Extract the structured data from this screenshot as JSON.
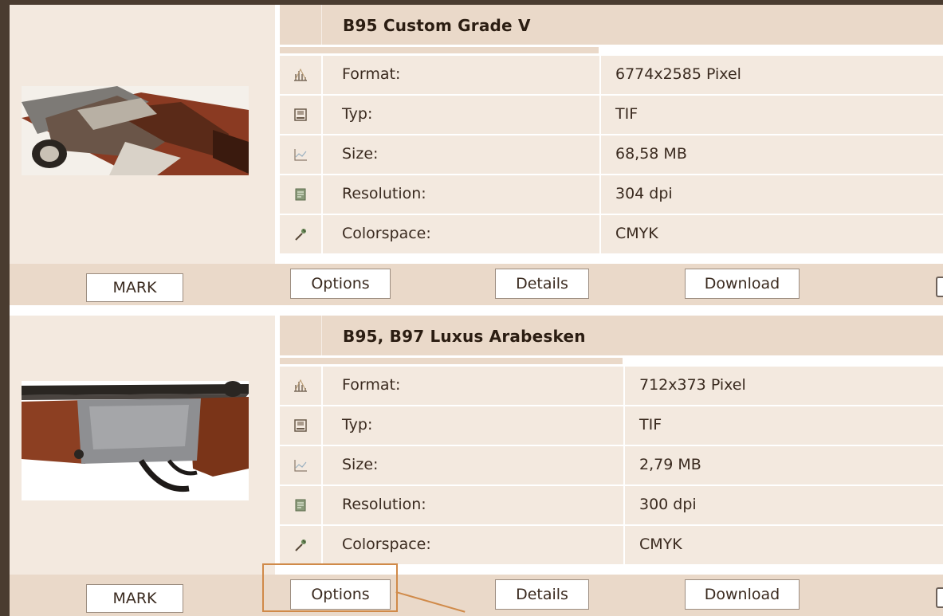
{
  "items": [
    {
      "title": "B95 Custom Grade V",
      "specs": [
        {
          "icon": "format-ruler-icon",
          "label": "Format:",
          "value": "6774x2585 Pixel"
        },
        {
          "icon": "file-type-icon",
          "label": "Typ:",
          "value": "TIF"
        },
        {
          "icon": "file-size-chart-icon",
          "label": "Size:",
          "value": "68,58 MB"
        },
        {
          "icon": "resolution-document-icon",
          "label": "Resolution:",
          "value": "304 dpi"
        },
        {
          "icon": "colorspace-eyedropper-icon",
          "label": "Colorspace:",
          "value": "CMYK"
        }
      ],
      "buttons": {
        "mark": "MARK",
        "options": "Options",
        "details": "Details",
        "download": "Download"
      }
    },
    {
      "title": "B95, B97 Luxus Arabesken",
      "specs": [
        {
          "icon": "format-ruler-icon",
          "label": "Format:",
          "value": "712x373 Pixel"
        },
        {
          "icon": "file-type-icon",
          "label": "Typ:",
          "value": "TIF"
        },
        {
          "icon": "file-size-chart-icon",
          "label": "Size:",
          "value": "2,79 MB"
        },
        {
          "icon": "resolution-document-icon",
          "label": "Resolution:",
          "value": "300 dpi"
        },
        {
          "icon": "colorspace-eyedropper-icon",
          "label": "Colorspace:",
          "value": "CMYK"
        }
      ],
      "buttons": {
        "mark": "MARK",
        "options": "Options",
        "details": "Details",
        "download": "Download"
      }
    }
  ],
  "colors": {
    "frame": "#4a3c30",
    "header_bg": "#ead9c9",
    "row_bg": "#f3e9df",
    "highlight": "#d08a49"
  }
}
